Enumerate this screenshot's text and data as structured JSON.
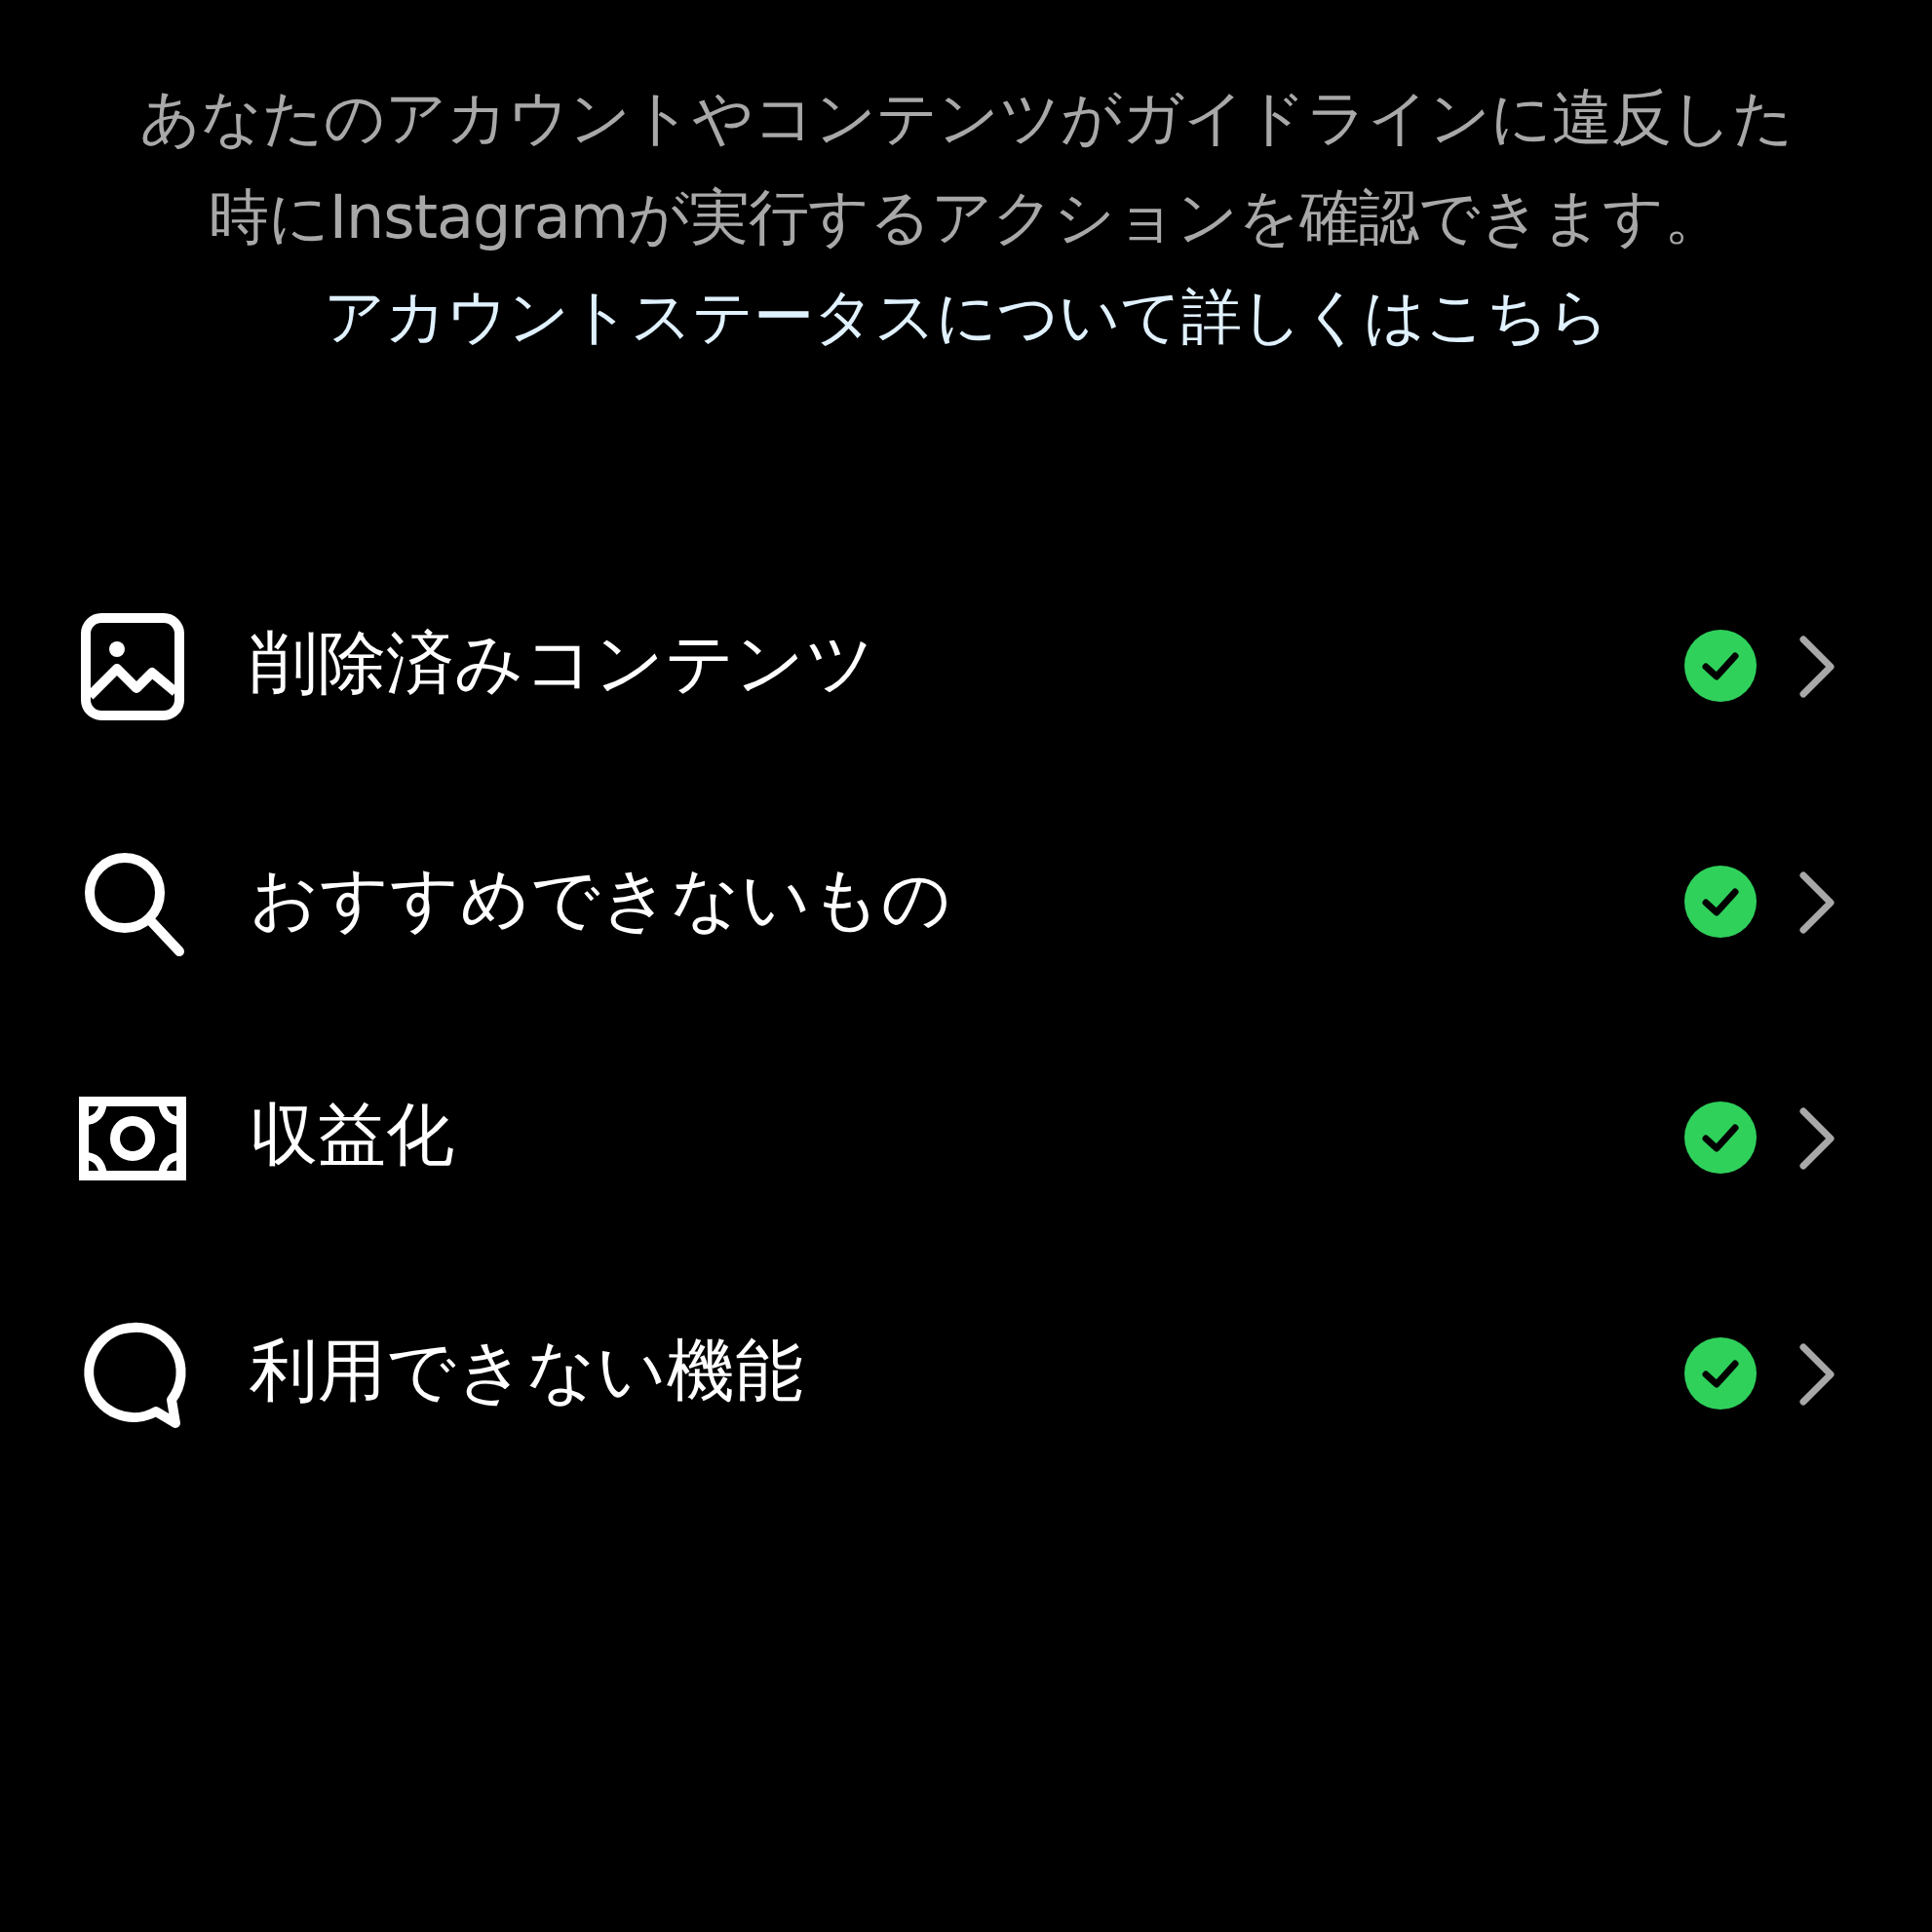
{
  "description": {
    "text": "あなたのアカウントやコンテンツがガイドラインに違反した時にInstagramが実行するアクションを確認できます。",
    "link": "アカウントステータスについて詳しくはこちら"
  },
  "items": [
    {
      "kind": "picture",
      "label": "削除済みコンテンツ",
      "ok": true
    },
    {
      "kind": "search",
      "label": "おすすめできないもの",
      "ok": true
    },
    {
      "kind": "money",
      "label": "収益化",
      "ok": true
    },
    {
      "kind": "bubble",
      "label": "利用できない機能",
      "ok": true
    }
  ]
}
